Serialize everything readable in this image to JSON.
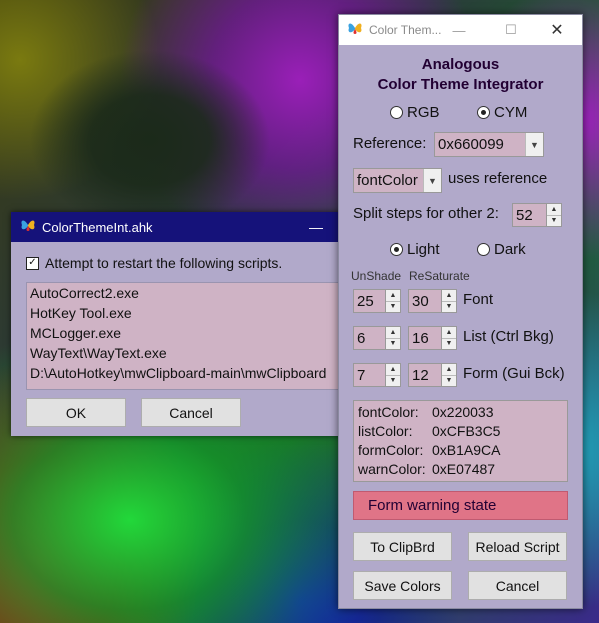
{
  "back_window": {
    "title": "ColorThemeInt.ahk",
    "minimize_glyph": "—",
    "checkbox_checked": true,
    "checkbox_label": "Attempt to restart the following scripts.",
    "scripts": [
      "AutoCorrect2.exe",
      "HotKey Tool.exe",
      "MCLogger.exe",
      "WayText\\WayText.exe",
      "D:\\AutoHotkey\\mwClipboard-main\\mwClipboard"
    ],
    "ok_label": "OK",
    "cancel_label": "Cancel"
  },
  "front_window": {
    "title": "Color Them...",
    "heading_line1": "Analogous",
    "heading_line2": "Color Theme Integrator",
    "radio_rgb": "RGB",
    "radio_cym": "CYM",
    "selected_mode": "CYM",
    "reference_label": "Reference:",
    "reference_value": "0x660099",
    "font_color_select": "fontColor",
    "uses_reference_label": "uses reference",
    "split_steps_label": "Split steps for other 2:",
    "split_steps_value": "52",
    "radio_light": "Light",
    "radio_dark": "Dark",
    "selected_theme": "Light",
    "unshade_label": "UnShade",
    "resaturate_label": "ReSaturate",
    "rows": [
      {
        "unshade": "25",
        "resaturate": "30",
        "label": "Font"
      },
      {
        "unshade": "6",
        "resaturate": "16",
        "label": "List (Ctrl Bkg)"
      },
      {
        "unshade": "7",
        "resaturate": "12",
        "label": "Form (Gui Bck)"
      }
    ],
    "colors": [
      {
        "name": "fontColor:",
        "value": "0x220033"
      },
      {
        "name": "listColor:",
        "value": "0xCFB3C5"
      },
      {
        "name": "formColor:",
        "value": "0xB1A9CA"
      },
      {
        "name": "warnColor:",
        "value": "0xE07487"
      }
    ],
    "warning_text": "Form warning state",
    "to_clipbrd_label": "To ClipBrd",
    "reload_script_label": "Reload Script",
    "save_colors_label": "Save Colors",
    "cancel_label": "Cancel",
    "accent_colors": {
      "font": "#220033",
      "list": "#CFB3C5",
      "form": "#B1A9CA",
      "warn": "#E07487"
    }
  }
}
